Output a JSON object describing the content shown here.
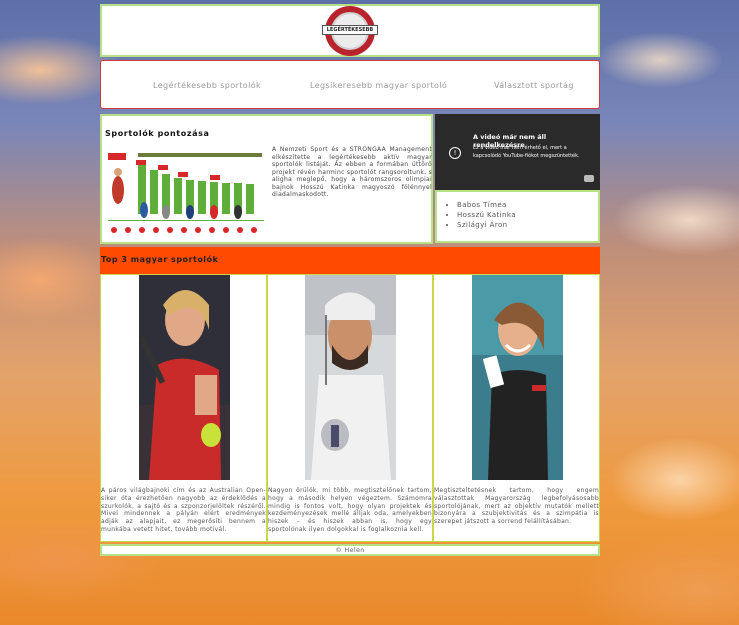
{
  "header": {
    "logo_text": "LEGÉRTÉKESEBB"
  },
  "nav": {
    "items": [
      "Legértékesebb sportolók",
      "Legsikeresebb magyar sportoló",
      "Választott sportág"
    ]
  },
  "section": {
    "title": "Sportolók pontozása",
    "text": "A Nemzeti Sport és a STRONGAA Management elkészítette a legértékesebb aktív magyar sportolók listáját. Az ebben a formában úttörő projekt révén harminc sportolót rangsoroltunk, s aligha meglepő, hogy a háromszoros olimpiai bajnok Hosszú Katinka magyoszó fölénnyel diadalmaskodott."
  },
  "video": {
    "title": "A videó már nem áll rendelkezésre",
    "message": "Ez a videó már nem érhető el, mert a kapcsolódó YouTube-fiókot megszüntették."
  },
  "athletes": [
    "Babos Tímea",
    "Hosszú Katinka",
    "Szilágyi Áron"
  ],
  "top3": {
    "title": "Top 3 magyar sportolók",
    "cards": [
      {
        "text": "A páros világbajnoki cím és az Australian Open-siker óta érezhetően nagyobb az érdeklődés a szurkolók, a sajtó és a szponzorjelöltek részéről. Mivel mindennek a pályán elért eredmények adják az alapjait, ez megerősíti bennem a munkába vetett hitet, tovább motivál."
      },
      {
        "text": "Nagyon örülök, mi több, megtisztelőnek tartom, hogy a második helyen végeztem. Számomra mindig is fontos volt, hogy olyan projektek és kezdeményezések mellé álljak oda, amelyekben hiszek – és hiszek abban is, hogy egy sportolónak ilyen dolgokkal is foglalkoznia kell."
      },
      {
        "text": "Megtiszteltetésnek tartom, hogy engem választottak Magyarország legbefolyásosabb sportolójának, mert az objektív mutatók mellett bizonyára a szubjektivitás és a szimpátia is szerepet játszott a sorrend felállításában."
      }
    ]
  },
  "footer": {
    "text": "© Helen"
  }
}
